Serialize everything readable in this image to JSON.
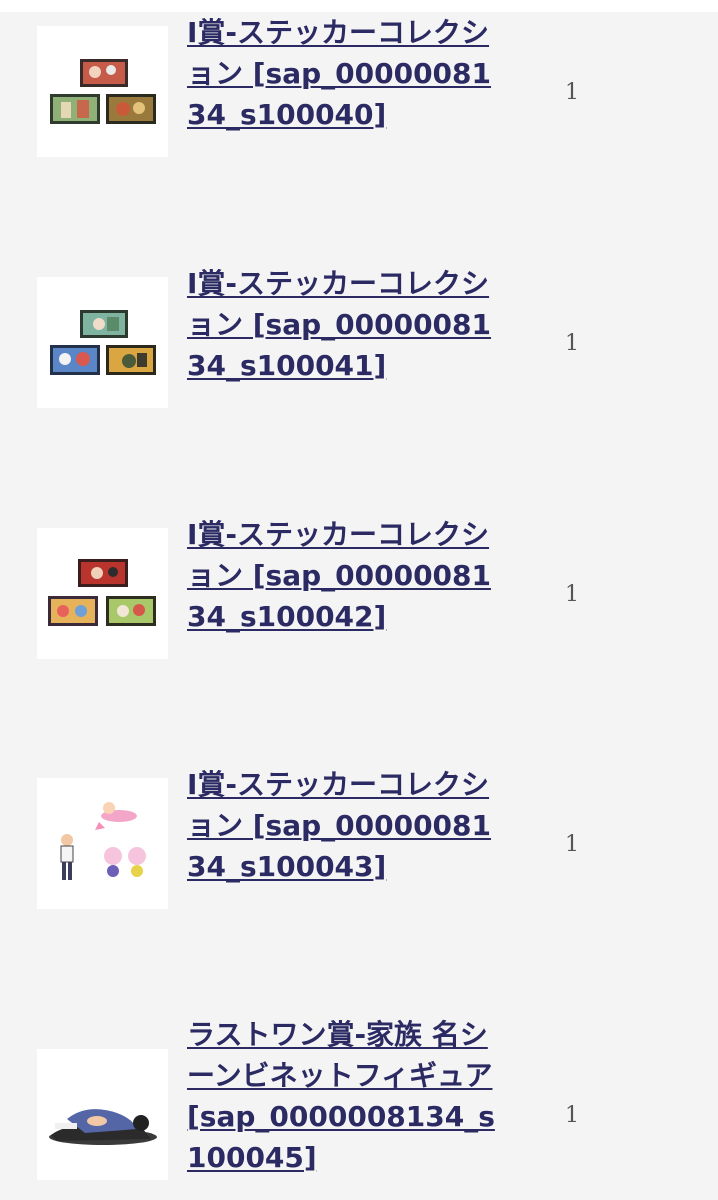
{
  "items": [
    {
      "name": "I賞-ステッカーコレクション [sap_0000008134_s100040]",
      "quantity": "1",
      "thumbnail": "sticker-collection-image"
    },
    {
      "name": "I賞-ステッカーコレクション [sap_0000008134_s100041]",
      "quantity": "1",
      "thumbnail": "sticker-collection-image"
    },
    {
      "name": "I賞-ステッカーコレクション [sap_0000008134_s100042]",
      "quantity": "1",
      "thumbnail": "sticker-collection-image"
    },
    {
      "name": "I賞-ステッカーコレクション [sap_0000008134_s100043]",
      "quantity": "1",
      "thumbnail": "sticker-character-image"
    },
    {
      "name": "ラストワン賞-家族 名シーンビネットフィギュア [sap_0000008134_s100045]",
      "quantity": "1",
      "thumbnail": "figure-image"
    }
  ],
  "colors": {
    "link": "#2b2a63",
    "background": "#f4f4f4",
    "thumbnail_bg": "#ffffff"
  }
}
